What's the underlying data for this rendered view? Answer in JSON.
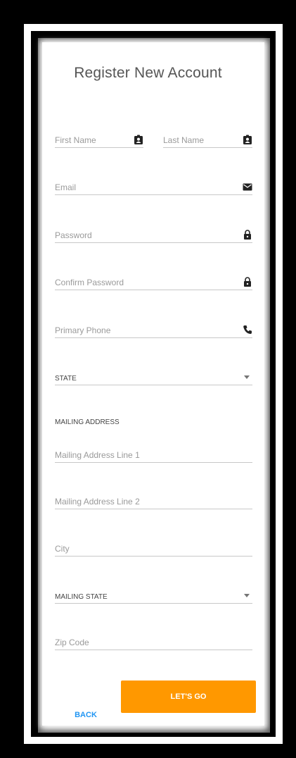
{
  "form": {
    "title": "Register New Account",
    "first_name": {
      "placeholder": "First Name",
      "icon": "contact-card-icon"
    },
    "last_name": {
      "placeholder": "Last Name",
      "icon": "contact-card-icon"
    },
    "email": {
      "placeholder": "Email",
      "icon": "envelope-icon"
    },
    "password": {
      "placeholder": "Password",
      "icon": "lock-icon"
    },
    "confirm_password": {
      "placeholder": "Confirm Password",
      "icon": "lock-icon"
    },
    "primary_phone": {
      "placeholder": "Primary Phone",
      "icon": "phone-icon"
    },
    "state": {
      "label": "STATE"
    },
    "mailing_section": "MAILING ADDRESS",
    "mailing_line1": {
      "placeholder": "Mailing Address Line 1"
    },
    "mailing_line2": {
      "placeholder": "Mailing Address Line 2"
    },
    "city": {
      "placeholder": "City"
    },
    "mailing_state": {
      "label": "MAILING STATE"
    },
    "zip": {
      "placeholder": "Zip Code"
    }
  },
  "actions": {
    "back_label": "BACK",
    "submit_label": "LET'S GO"
  },
  "colors": {
    "accent": "#ff9800",
    "link": "#2196f3"
  }
}
